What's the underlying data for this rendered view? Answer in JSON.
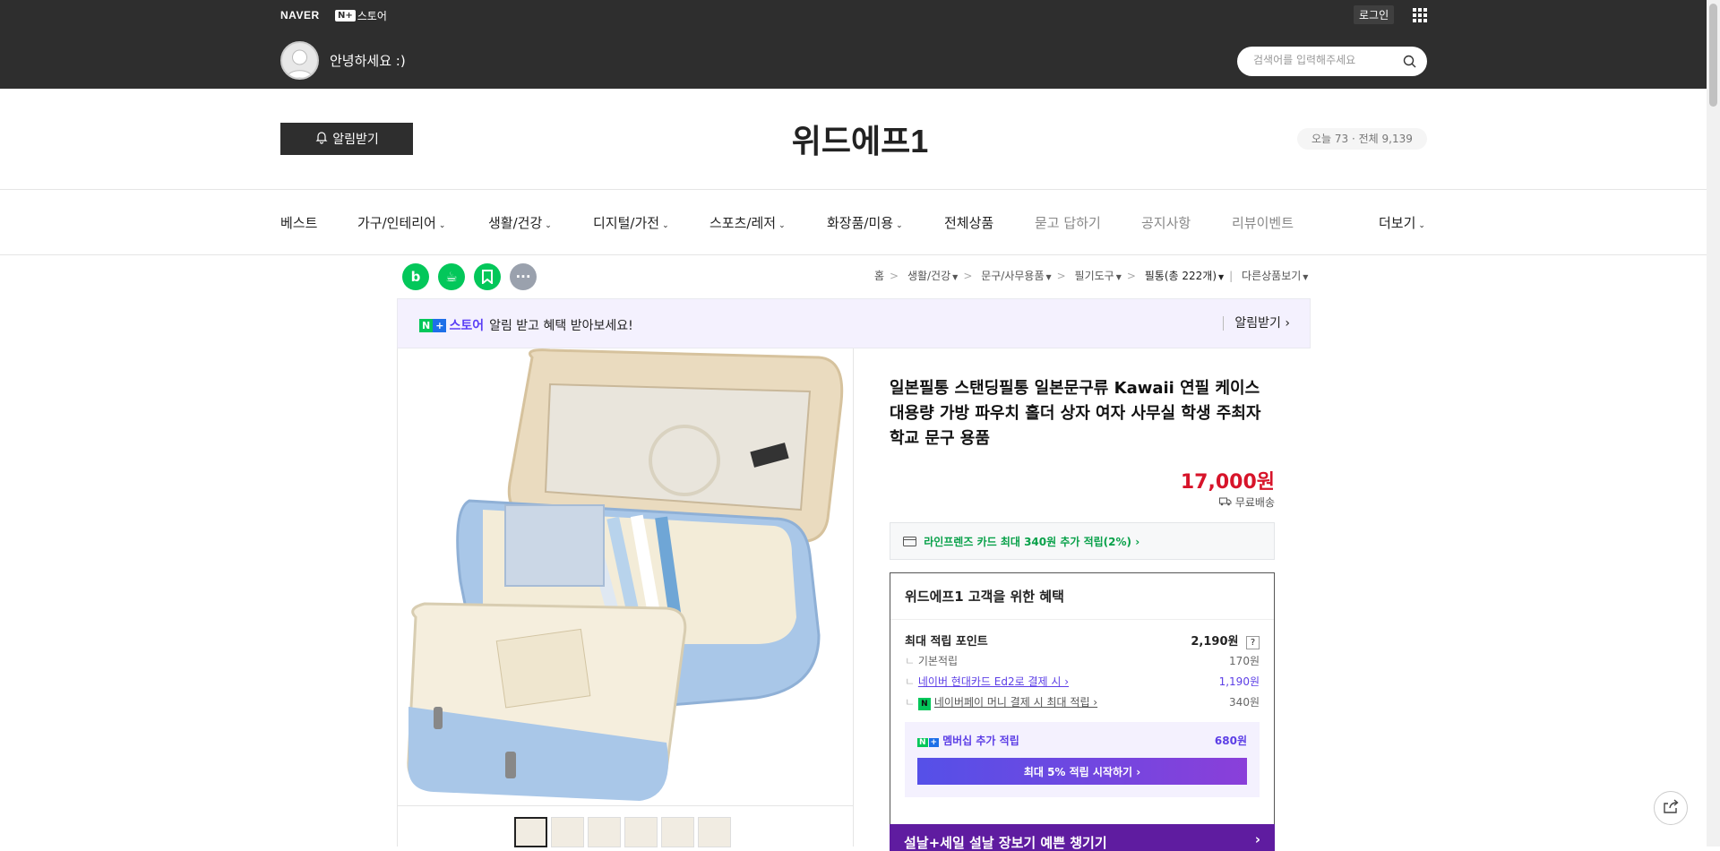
{
  "topbar": {
    "naver_logo": "NAVER",
    "store_logo_mark": "N+",
    "store_logo_text": "스토어",
    "login": "로그인",
    "greeting": "안녕하세요 :)",
    "search_placeholder": "검색어를 입력해주세요"
  },
  "header": {
    "alarm_button": "알림받기",
    "store_name": "위드에프1",
    "visits": "오늘 73 · 전체 9,139"
  },
  "nav": [
    {
      "label": "베스트",
      "dropdown": false
    },
    {
      "label": "가구/인테리어",
      "dropdown": true
    },
    {
      "label": "생활/건강",
      "dropdown": true
    },
    {
      "label": "디지털/가전",
      "dropdown": true
    },
    {
      "label": "스포츠/레저",
      "dropdown": true
    },
    {
      "label": "화장품/미용",
      "dropdown": true
    },
    {
      "label": "전체상품",
      "dropdown": false
    },
    {
      "label": "묻고 답하기",
      "dropdown": false
    },
    {
      "label": "공지사항",
      "dropdown": false
    },
    {
      "label": "리뷰이벤트",
      "dropdown": false
    },
    {
      "label": "더보기",
      "dropdown": true
    }
  ],
  "breadcrumb": {
    "home": "홈",
    "cat1": "생활/건강",
    "cat2": "문구/사무용품",
    "cat3": "필기도구",
    "cat4": "필통(총 222개)",
    "other": "다른상품보기"
  },
  "share_icons": [
    "blog-icon",
    "cafe-icon",
    "bookmark-icon",
    "more-icon"
  ],
  "promo": {
    "logo_n": "N",
    "logo_plus": "+",
    "logo_store": "스토어",
    "text": "알림 받고 혜택 받아보세요!",
    "action": "알림받기 ›"
  },
  "product": {
    "title": "일본필통 스탠딩필통 일본문구류 Kawaii 연필 케이스 대용량 가방 파우치 홀더 상자 여자 사무실 학생 주최자 학교 문구 용품",
    "price": "17,000원",
    "shipping": "무료배송",
    "card_promo": "라인프렌즈 카드 최대 340원 추가 적립(2%) ›",
    "thumb_count": 6
  },
  "benefit": {
    "title": "위드에프1 고객을 위한 혜택",
    "max_points_label": "최대 적립 포인트",
    "max_points_value": "2,190원",
    "help": "?",
    "base_label": "기본적립",
    "base_value": "170원",
    "card_label": "네이버 현대카드 Ed2로 결제 시 ›",
    "card_value": "1,190원",
    "pay_label": "네이버페이 머니 결제 시 최대 적립 ›",
    "pay_value": "340원",
    "membership_label": "멤버십 추가 적립",
    "membership_value": "680원",
    "membership_button": "최대 5% 적립 시작하기 ›"
  },
  "banner": {
    "text": "설날+세일    설날 장보기 예쁜 챙기기"
  },
  "colors": {
    "topbar": "#2e2e2e",
    "price_red": "#d7142a",
    "naver_green": "#03c75a",
    "membership_purple": "#5c3ee6"
  }
}
